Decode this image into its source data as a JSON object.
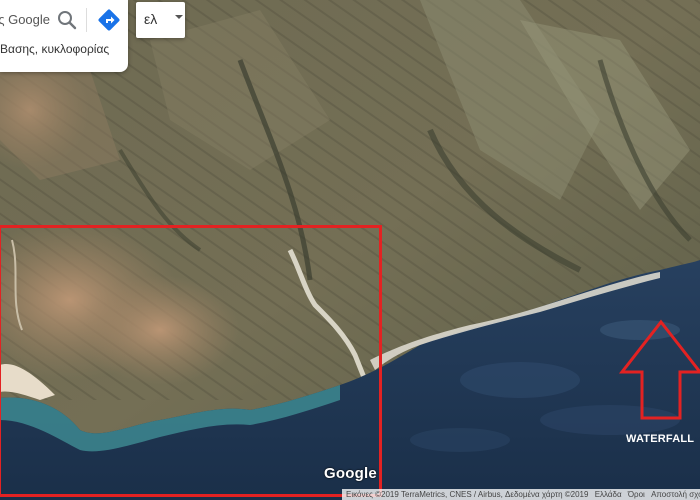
{
  "search": {
    "value": "ες Google",
    "suggestion": "Βασης, κυκλοφορίας"
  },
  "language": {
    "selected": "ελ"
  },
  "icons": {
    "search": "search-icon",
    "directions": "directions-icon",
    "dropdown": "chevron-down-icon"
  },
  "annotation": {
    "label": "WATERFALL",
    "color": "#e32222"
  },
  "map": {
    "logo": "Google",
    "attribution": {
      "imagery": "Εικόνες ©2019 TerraMetrics, CNES / Airbus, Δεδομένα χάρτη ©2019",
      "region": "Ελλάδα",
      "terms": "Όροι",
      "send_feedback": "Αποστολή σχολίων"
    }
  },
  "colors": {
    "sea_deep": "#1e3552",
    "sea_shallow": "#3a7e8e",
    "land": "#6f6e55",
    "land_light": "#a58c6e",
    "beach": "#e9dfcf"
  }
}
